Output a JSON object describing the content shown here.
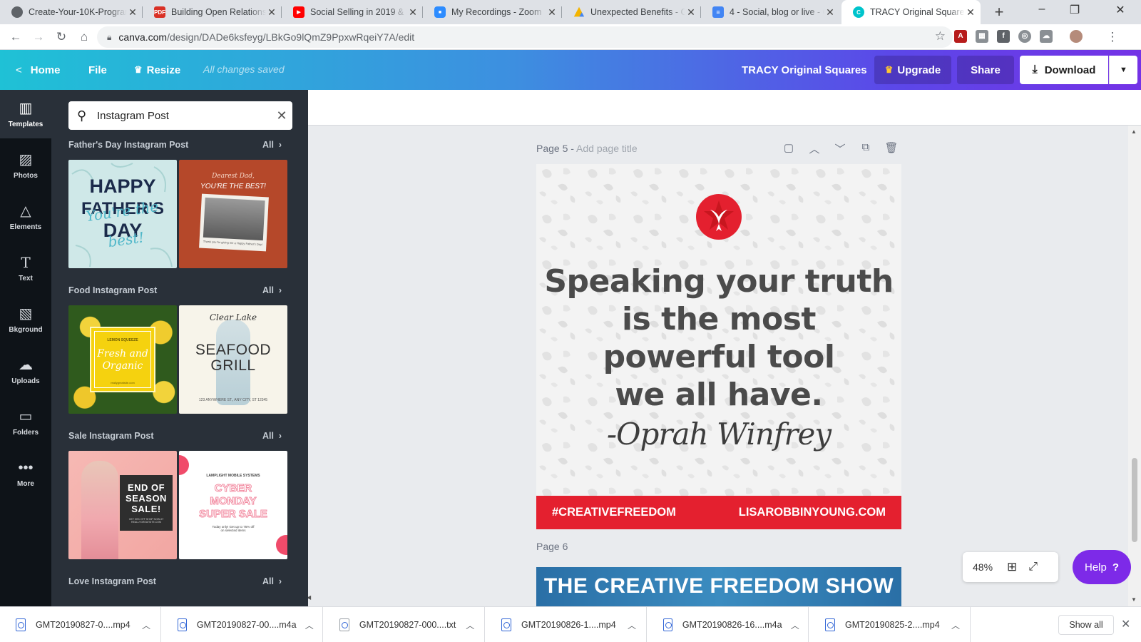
{
  "browser": {
    "tabs": [
      {
        "title": "Create-Your-10K-Program",
        "icon": "page-icon"
      },
      {
        "title": "Building Open Relationships",
        "icon": "pdf-icon"
      },
      {
        "title": "Social Selling in 2019 & Beyond",
        "icon": "youtube-icon"
      },
      {
        "title": "My Recordings - Zoom",
        "icon": "zoom-icon"
      },
      {
        "title": "Unexpected Benefits - Google Drive",
        "icon": "drive-icon"
      },
      {
        "title": "4 - Social, blog or live - Google Docs",
        "icon": "docs-icon"
      },
      {
        "title": "TRACY Original Squares",
        "icon": "canva-icon"
      }
    ],
    "url_host": "canva.com",
    "url_path": "/design/DADe6ksfeyg/LBkGo9lQmZ9PpxwRqeiY7A/edit"
  },
  "header": {
    "home_label": "Home",
    "file_label": "File",
    "resize_label": "Resize",
    "saved_status": "All changes saved",
    "design_title": "TRACY Original Squares",
    "upgrade_label": "Upgrade",
    "share_label": "Share",
    "download_label": "Download"
  },
  "rail": [
    {
      "label": "Templates",
      "icon": "templates-icon"
    },
    {
      "label": "Photos",
      "icon": "photos-icon"
    },
    {
      "label": "Elements",
      "icon": "elements-icon"
    },
    {
      "label": "Text",
      "icon": "text-icon"
    },
    {
      "label": "Bkground",
      "icon": "background-icon"
    },
    {
      "label": "Uploads",
      "icon": "uploads-icon"
    },
    {
      "label": "Folders",
      "icon": "folders-icon"
    },
    {
      "label": "More",
      "icon": "more-icon"
    }
  ],
  "panel": {
    "search_value": "Instagram Post",
    "all_label": "All",
    "sections": [
      {
        "title": "Father's Day Instagram Post"
      },
      {
        "title": "Food Instagram Post"
      },
      {
        "title": "Sale Instagram Post"
      },
      {
        "title": "Love Instagram Post"
      }
    ],
    "thumbs": {
      "fathers_happy": "HAPPY",
      "fathers_fathers": "FATHER'S",
      "fathers_day": "DAY",
      "fathers_script": "You're the best!",
      "dad_top": "Dearest Dad,",
      "dad_main": "YOU'RE THE BEST!",
      "dad_small": "Thank you for giving me a Happy Father's Day!",
      "lemon_brand": "LEMON SQUEEZE",
      "lemon_main": "Fresh and Organic",
      "lemon_url": "reallygreatsite.com",
      "seafood_script": "Clear Lake",
      "seafood_main1": "SEAFOOD",
      "seafood_main2": "GRILL",
      "seafood_addr": "123 ANYWHERE ST., ANY CITY, ST 12345",
      "sale_line1": "END OF",
      "sale_line2": "SEASON",
      "sale_line3": "SALE!",
      "sale_small": "GET 50% OFF SHOP NOW AT REALLYGREATSITE.COM",
      "cyber_brand": "LAMPLIGHT MOBILE SYSTEMS",
      "cyber_line1": "CYBER",
      "cyber_line2": "MONDAY",
      "cyber_line3": "SUPER SALE",
      "cyber_small1": "Today only! Get up to 75% off",
      "cyber_small2": "on selected items"
    }
  },
  "editor": {
    "page5_label": "Page 5 - ",
    "page5_placeholder": "Add page title",
    "quote_lines": [
      "Speaking your truth",
      "is the most",
      "powerful tool",
      "we all have."
    ],
    "author": "-Oprah Winfrey",
    "hashtag": "#CREATIVEFREEDOM",
    "website": "LISAROBBINYOUNG.COM",
    "page6_label": "Page 6",
    "page6_banner": "THE CREATIVE FREEDOM SHOW",
    "zoom": "48%",
    "help_label": "Help",
    "brand_red": "#e4202f"
  },
  "downloads": {
    "files": [
      "GMT20190827-0....mp4",
      "GMT20190827-00....m4a",
      "GMT20190827-000....txt",
      "GMT20190826-1....mp4",
      "GMT20190826-16....m4a",
      "GMT20190825-2....mp4"
    ],
    "show_all": "Show all"
  }
}
